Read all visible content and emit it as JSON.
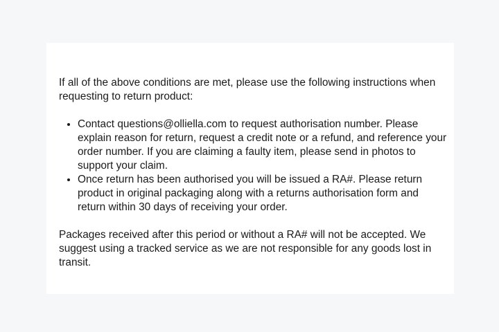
{
  "returns": {
    "intro": "If all of the above conditions are met, please use the following instructions when requesting to return product:",
    "steps": [
      "Contact questions@olliella.com to request authorisation number. Please explain reason for return, request a credit note or a refund, and reference your order number. If you are claiming a faulty item, please send in photos to support your claim.",
      "Once return has been authorised you will be issued a RA#. Please return product in original packaging along with a returns authorisation form and return within 30 days of receiving your order."
    ],
    "note": "Packages received after this period or without a RA# will not be accepted. We suggest using a tracked service as we are not responsible for any goods lost in transit."
  }
}
